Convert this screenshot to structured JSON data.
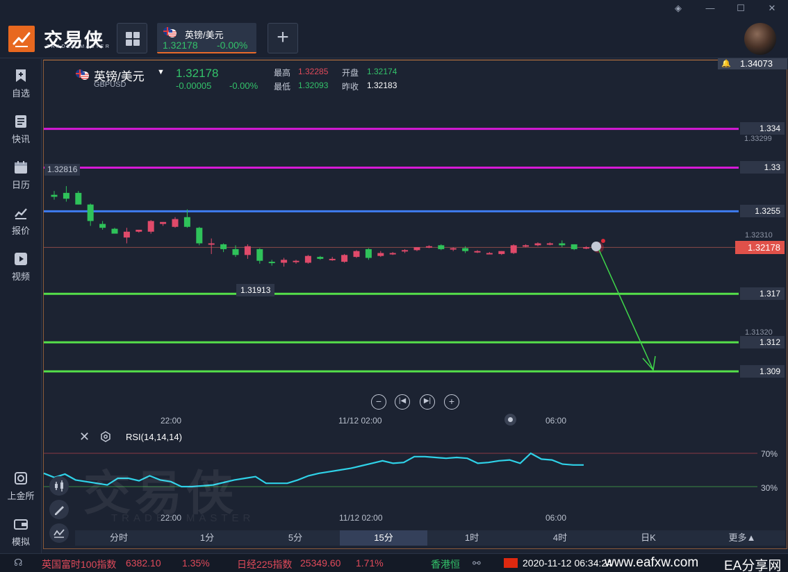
{
  "app": {
    "brand_cn": "交易侠",
    "brand_en": "TRADER MASTER"
  },
  "tab": {
    "name": "英镑/美元",
    "price": "1.32178",
    "change_pct": "-0.00%"
  },
  "sidebar": {
    "items": [
      {
        "label": "自选",
        "icon": "bookmark-plus-icon"
      },
      {
        "label": "快讯",
        "icon": "news-list-icon"
      },
      {
        "label": "日历",
        "icon": "calendar-icon"
      },
      {
        "label": "报价",
        "icon": "chart-line-icon"
      },
      {
        "label": "视频",
        "icon": "video-play-icon"
      },
      {
        "label": "上金所",
        "icon": "gold-exchange-icon"
      },
      {
        "label": "模拟",
        "icon": "wallet-icon"
      }
    ]
  },
  "quote": {
    "name": "英镑/美元",
    "code": "GBPUSD",
    "price": "1.32178",
    "change": "-0.00005",
    "change_pct": "-0.00%",
    "high_label": "最高",
    "high": "1.32285",
    "low_label": "最低",
    "low": "1.32093",
    "open_label": "开盘",
    "open": "1.32174",
    "prev_close_label": "昨收",
    "prev_close": "1.32183"
  },
  "price_axis": {
    "top": "1.34073",
    "level_1": "1.33299",
    "level_2": "1.32310",
    "level_3": "1.31320",
    "current": "1.32178"
  },
  "lines": [
    {
      "label": "1.334",
      "color": "#d61ad6"
    },
    {
      "label": "1.33",
      "color": "#d61ad6"
    },
    {
      "label": "1.3255",
      "color": "#3f7cf0"
    },
    {
      "label": "1.317",
      "color": "#55e04a"
    },
    {
      "label": "1.312",
      "color": "#55e04a"
    },
    {
      "label": "1.309",
      "color": "#55e04a"
    }
  ],
  "annotations": {
    "high_marker": "1.32816",
    "low_marker": "1.31913"
  },
  "time_axis": [
    "22:00",
    "11/12 02:00",
    "06:00"
  ],
  "indicator": {
    "name": "RSI(14,14,14)",
    "upper": "70%",
    "lower": "30%"
  },
  "timeframes": {
    "items": [
      "分时",
      "1分",
      "5分",
      "15分",
      "1时",
      "4时",
      "日K"
    ],
    "active": "15分",
    "more": "更多"
  },
  "ticker": {
    "items": [
      {
        "name": "英国富时100指数",
        "value": "6382.10",
        "change": "1.35%"
      },
      {
        "name": "日经225指数",
        "value": "25349.60",
        "change": "1.71%"
      }
    ],
    "next": "香港恒",
    "datetime": "2020-11-12 06:34:24",
    "watermark_site": "www.eafxw.com",
    "watermark_name": "EA分享网"
  },
  "colors": {
    "up": "#33c26a",
    "down": "#e04a5a",
    "accent": "#e8681f"
  },
  "chart_data": {
    "type": "candlestick",
    "symbol": "GBPUSD",
    "candles": [
      [
        1.3272,
        1.3276,
        1.3267,
        1.327
      ],
      [
        1.3274,
        1.3281,
        1.3265,
        1.3268
      ],
      [
        1.3274,
        1.3276,
        1.3262,
        1.3262
      ],
      [
        1.3262,
        1.3263,
        1.324,
        1.3245
      ],
      [
        1.3242,
        1.3245,
        1.3236,
        1.3238
      ],
      [
        1.3237,
        1.3238,
        1.3232,
        1.3232
      ],
      [
        1.3228,
        1.3238,
        1.3222,
        1.3234
      ],
      [
        1.3234,
        1.3236,
        1.3233,
        1.3236
      ],
      [
        1.3234,
        1.3246,
        1.3232,
        1.3245
      ],
      [
        1.3242,
        1.3244,
        1.324,
        1.3244
      ],
      [
        1.3239,
        1.3249,
        1.3238,
        1.3247
      ],
      [
        1.3249,
        1.3257,
        1.3238,
        1.3239
      ],
      [
        1.3238,
        1.3239,
        1.322,
        1.3222
      ],
      [
        1.3222,
        1.3227,
        1.3211,
        1.3222
      ],
      [
        1.3221,
        1.3222,
        1.3213,
        1.3216
      ],
      [
        1.3216,
        1.322,
        1.3208,
        1.321
      ],
      [
        1.321,
        1.3221,
        1.3206,
        1.3219
      ],
      [
        1.3216,
        1.3217,
        1.3201,
        1.3204
      ],
      [
        1.3203,
        1.3205,
        1.3199,
        1.3202
      ],
      [
        1.3202,
        1.3207,
        1.3198,
        1.3205
      ],
      [
        1.3204,
        1.3205,
        1.3201,
        1.3204
      ],
      [
        1.3202,
        1.321,
        1.3201,
        1.3209
      ],
      [
        1.3208,
        1.3209,
        1.3205,
        1.3206
      ],
      [
        1.3205,
        1.3208,
        1.3204,
        1.3206
      ],
      [
        1.3203,
        1.3211,
        1.3202,
        1.321
      ],
      [
        1.3208,
        1.3215,
        1.3207,
        1.3214
      ],
      [
        1.3216,
        1.3217,
        1.3205,
        1.3207
      ],
      [
        1.3209,
        1.3214,
        1.3208,
        1.3212
      ],
      [
        1.3211,
        1.3213,
        1.321,
        1.3212
      ],
      [
        1.3214,
        1.3216,
        1.3212,
        1.3215
      ],
      [
        1.3215,
        1.3218,
        1.3214,
        1.3218
      ],
      [
        1.3219,
        1.322,
        1.3217,
        1.3219
      ],
      [
        1.322,
        1.3221,
        1.3215,
        1.3216
      ],
      [
        1.3216,
        1.3218,
        1.3214,
        1.3217
      ],
      [
        1.3217,
        1.3219,
        1.3212,
        1.3214
      ],
      [
        1.3213,
        1.3215,
        1.3212,
        1.3214
      ],
      [
        1.3212,
        1.3213,
        1.3211,
        1.3212
      ],
      [
        1.3211,
        1.3214,
        1.321,
        1.3214
      ],
      [
        1.3212,
        1.3221,
        1.3211,
        1.322
      ],
      [
        1.322,
        1.3221,
        1.3218,
        1.322
      ],
      [
        1.322,
        1.3223,
        1.3219,
        1.3222
      ],
      [
        1.3221,
        1.3223,
        1.322,
        1.3222
      ],
      [
        1.3222,
        1.3225,
        1.3218,
        1.322
      ],
      [
        1.3221,
        1.3221,
        1.3215,
        1.3216
      ],
      [
        1.3217,
        1.3219,
        1.3216,
        1.3218
      ],
      [
        1.3218,
        1.322,
        1.3216,
        1.3219
      ]
    ],
    "rsi": [
      46,
      41,
      45,
      38,
      36,
      34,
      32,
      40,
      40,
      37,
      43,
      38,
      36,
      30,
      30,
      31,
      32,
      35,
      38,
      40,
      42,
      34,
      34,
      34,
      38,
      43,
      46,
      48,
      50,
      52,
      55,
      58,
      61,
      58,
      59,
      66,
      66,
      65,
      64,
      65,
      64,
      58,
      59,
      61,
      62,
      58,
      70,
      63,
      62,
      57,
      56,
      56
    ],
    "horizontal_lines": [
      1.334,
      1.33,
      1.3255,
      1.317,
      1.312,
      1.309
    ],
    "ylim": [
      1.308,
      1.3407
    ]
  }
}
